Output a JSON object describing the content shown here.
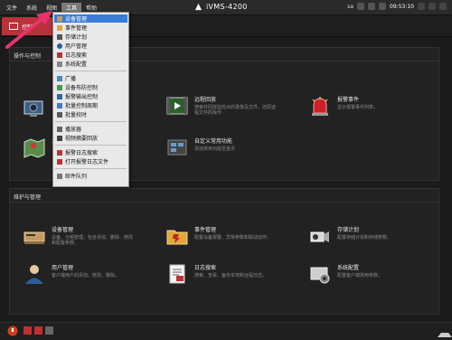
{
  "menubar": {
    "items": [
      "文件",
      "系统",
      "视图",
      "工具",
      "帮助"
    ],
    "active_index": 3
  },
  "app": {
    "title": "iVMS-4200",
    "user": "sa",
    "time": "09:53:10"
  },
  "tab": {
    "label": "控制"
  },
  "panel_ops": {
    "title": "操作与控制",
    "items": [
      {
        "name": "",
        "desc": ""
      },
      {
        "name": "远程回放",
        "desc": "搜索并回放监控点的录像及文件，还原远程文件的操作"
      },
      {
        "name": "报警事件",
        "desc": "显示报警事件列表。"
      },
      {
        "name": "地",
        "desc": ""
      },
      {
        "name": "自定义常用功能",
        "desc": "添加常用功能至首页"
      }
    ]
  },
  "panel_maint": {
    "title": "维护与管理",
    "items": [
      {
        "name": "设备管理",
        "desc": "设备、分组管理，包含添加、删除、修改和配置参数。"
      },
      {
        "name": "事件管理",
        "desc": "配置设备报警、异常参数和联动动作。"
      },
      {
        "name": "存储计划",
        "desc": "配置存储计划和存储参数。"
      },
      {
        "name": "用户管理",
        "desc": "客户端用户的添加、修改、删除。"
      },
      {
        "name": "日志搜索",
        "desc": "搜索、查看、备份本地和远程日志。"
      },
      {
        "name": "系统配置",
        "desc": "配置客户端常用参数。"
      }
    ]
  },
  "dropdown": {
    "items": [
      {
        "label": "设备管理",
        "icon": "device-icon"
      },
      {
        "label": "事件管理",
        "icon": "event-icon"
      },
      {
        "label": "存储计划",
        "icon": "storage-icon"
      },
      {
        "label": "用户管理",
        "icon": "user-icon"
      },
      {
        "label": "日志搜索",
        "icon": "log-icon"
      },
      {
        "label": "系统配置",
        "icon": "config-icon"
      },
      {
        "label": "广播",
        "icon": "broadcast-icon"
      },
      {
        "label": "设备布防控制",
        "icon": "arm-icon"
      },
      {
        "label": "报警输出控制",
        "icon": "alarm-output-icon"
      },
      {
        "label": "批量控制周期",
        "icon": "batch-icon"
      },
      {
        "label": "批量校时",
        "icon": "time-sync-icon"
      },
      {
        "label": "播放器",
        "icon": "player-icon"
      },
      {
        "label": "视频摘要回放",
        "icon": "video-summary-icon"
      },
      {
        "label": "报警日志搜索",
        "icon": "alarm-log-icon"
      },
      {
        "label": "打开报警日志文件",
        "icon": "open-file-icon"
      },
      {
        "label": "邮件队列",
        "icon": "mail-icon"
      }
    ],
    "highlighted_index": 0
  },
  "colors": {
    "accent": "#b8323a",
    "highlight": "#3a7bd5",
    "arrow": "#e8336e"
  }
}
